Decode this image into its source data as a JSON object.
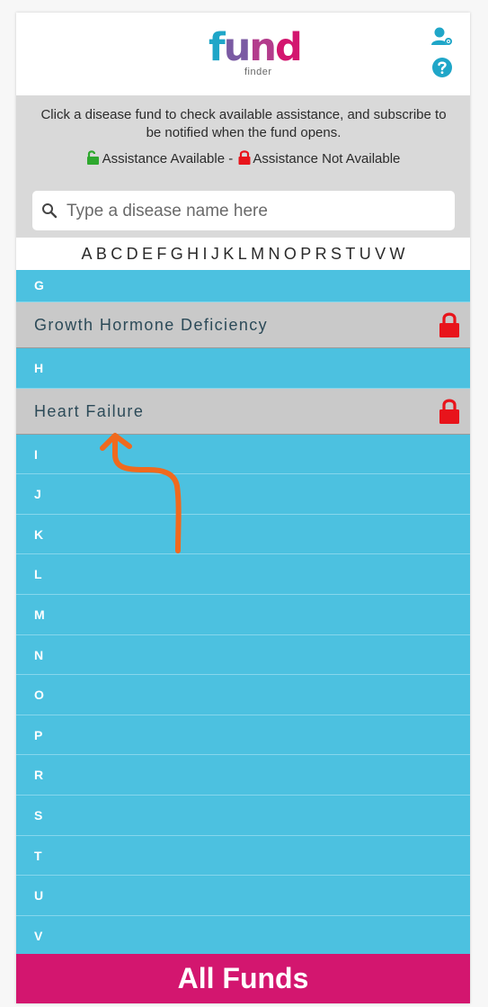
{
  "logo": {
    "word_f": "f",
    "word_u": "u",
    "word_n": "n",
    "word_d": "d",
    "sub": "finder"
  },
  "header": {
    "profile_icon": "user-gear-icon",
    "help_icon": "question-circle-icon"
  },
  "info": {
    "instructions": "Click a disease fund to check available assistance, and subscribe to be notified when the fund opens.",
    "legend_available": "Assistance Available - ",
    "legend_not_available": "Assistance Not Available"
  },
  "search": {
    "placeholder": "Type a disease name here",
    "value": ""
  },
  "alphabet": [
    "A",
    "B",
    "C",
    "D",
    "E",
    "F",
    "G",
    "H",
    "I",
    "J",
    "K",
    "L",
    "M",
    "N",
    "O",
    "P",
    "R",
    "S",
    "T",
    "U",
    "V",
    "W"
  ],
  "list": {
    "letter_g": "G",
    "fund_1": "Growth Hormone Deficiency",
    "letter_h": "H",
    "fund_2": "Heart Failure",
    "letters": [
      "I",
      "J",
      "K",
      "L",
      "M",
      "N",
      "O",
      "P",
      "R",
      "S",
      "T",
      "U",
      "V"
    ]
  },
  "footer": {
    "all_funds_label": "All Funds"
  },
  "colors": {
    "brand_blue": "#4cc1e0",
    "brand_magenta": "#d3166f",
    "lock_red": "#e8141b",
    "lock_green": "#2ea82e",
    "annotation_orange": "#f06a1e"
  }
}
